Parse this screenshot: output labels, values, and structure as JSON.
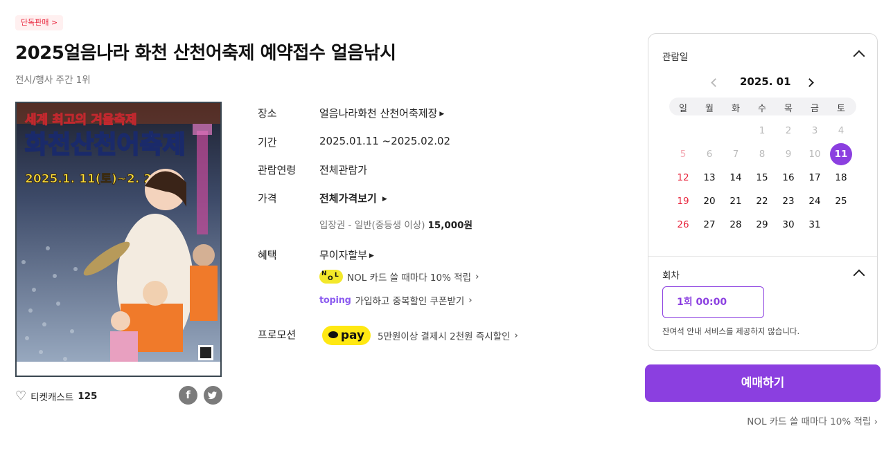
{
  "badge": "단독판매 >",
  "title": "2025얼음나라 화천 산천어축제 예약접수 얼음낚시",
  "rank": "전시/행사 주간 1위",
  "poster": {
    "line1": "세계 최고의 겨울축제",
    "line2": "화천산천어축제",
    "line3": "2025.1. 11(토)~2. 2(일)"
  },
  "like": {
    "label": "티켓캐스트",
    "count": "125"
  },
  "share": {
    "facebook": "f",
    "twitter": "t"
  },
  "info": {
    "place_label": "장소",
    "place_value": "얼음나라화천 산천어축제장",
    "period_label": "기간",
    "period_value": "2025.01.11 ~2025.02.02",
    "age_label": "관람연령",
    "age_value": "전체관람가",
    "price_label": "가격",
    "price_value": "전체가격보기",
    "price_sub_label": "입장권 - 일반(중등생 이상)",
    "price_sub_amount": "15,000원",
    "benefit_label": "혜택",
    "benefit_value": "무이자할부",
    "benefit_nol": "NOL 카드 쓸 때마다 10% 적립",
    "benefit_toping_logo": "toping",
    "benefit_toping": "가입하고 중복할인 쿠폰받기",
    "promo_label": "프로모션",
    "promo_pay": "pay",
    "promo_text": "5만원이상 결제시 2천원 즉시할인"
  },
  "calendar": {
    "header": "관람일",
    "month": "2025. 01",
    "weekdays": [
      "일",
      "월",
      "화",
      "수",
      "목",
      "금",
      "토"
    ],
    "selected_day": "11",
    "days": [
      "1",
      "2",
      "3",
      "4",
      "5",
      "6",
      "7",
      "8",
      "9",
      "10",
      "11",
      "12",
      "13",
      "14",
      "15",
      "16",
      "17",
      "18",
      "19",
      "20",
      "21",
      "22",
      "23",
      "24",
      "25",
      "26",
      "27",
      "28",
      "29",
      "30",
      "31"
    ]
  },
  "session": {
    "header": "회차",
    "option": "1회  00:00",
    "note": "잔여석 안내 서비스를 제공하지 않습니다."
  },
  "reserve_button": "예매하기",
  "nol_promo": "NOL 카드 쓸 때마다 10% 적립",
  "colors": {
    "accent": "#8b3fe0",
    "sunday": "#e8253c",
    "kakao": "#ffe812",
    "nol": "#f3e82a"
  }
}
